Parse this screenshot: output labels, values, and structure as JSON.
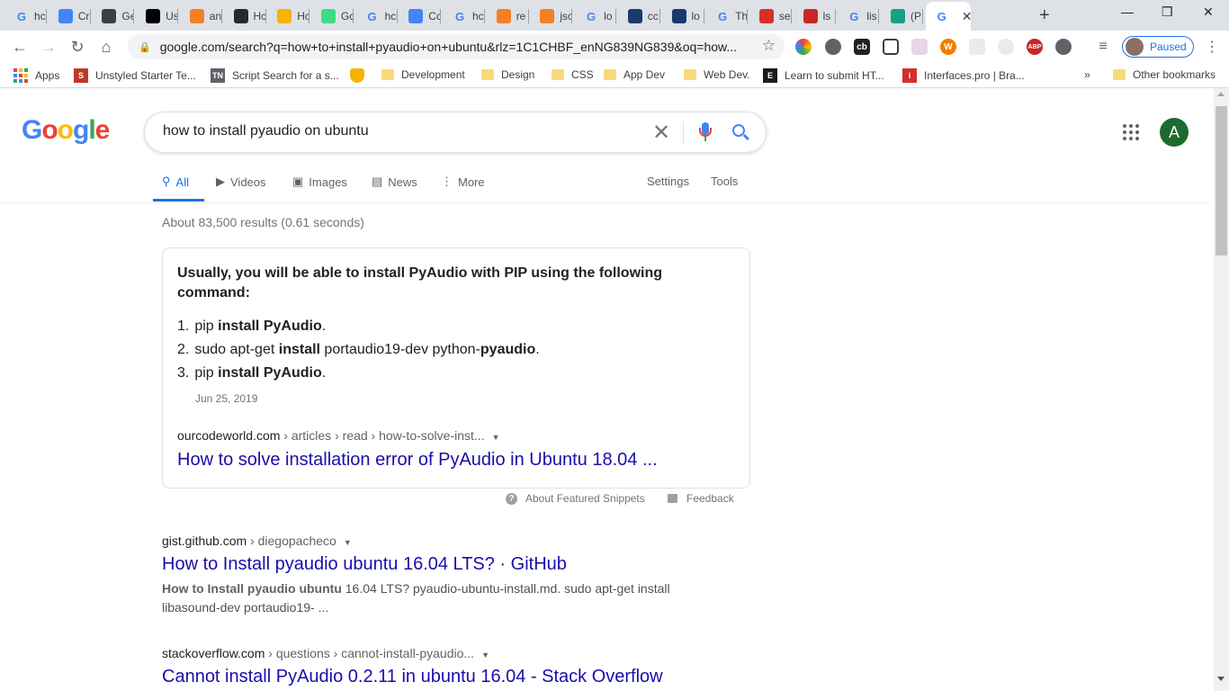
{
  "browser": {
    "tabs": [
      {
        "title": "hc",
        "icon": "google-icon",
        "color": "#4285f4"
      },
      {
        "title": "Cr",
        "icon": "cloud-icon",
        "color": "#4285f4"
      },
      {
        "title": "Ge",
        "icon": "code-icon",
        "color": "#3c4043"
      },
      {
        "title": "Us",
        "icon": "medium-icon",
        "color": "#000000"
      },
      {
        "title": "an",
        "icon": "stackoverflow-icon",
        "color": "#f48024"
      },
      {
        "title": "Hc",
        "icon": "github-icon",
        "color": "#24292e"
      },
      {
        "title": "Hc",
        "icon": "badge-icon",
        "color": "#f4b400"
      },
      {
        "title": "Gc",
        "icon": "android-icon",
        "color": "#3ddc84"
      },
      {
        "title": "hc",
        "icon": "google-icon",
        "color": "#4285f4"
      },
      {
        "title": "Cc",
        "icon": "docs-icon",
        "color": "#4285f4"
      },
      {
        "title": "hc",
        "icon": "google-icon",
        "color": "#4285f4"
      },
      {
        "title": "re",
        "icon": "stackoverflow-icon",
        "color": "#f48024"
      },
      {
        "title": "jsc",
        "icon": "stackoverflow-icon",
        "color": "#f48024"
      },
      {
        "title": "lo",
        "icon": "google-icon",
        "color": "#4285f4"
      },
      {
        "title": "cc",
        "icon": "ul-icon",
        "color": "#1a3a6b"
      },
      {
        "title": "lo",
        "icon": "ul-icon",
        "color": "#1a3a6b"
      },
      {
        "title": "Th",
        "icon": "google-icon",
        "color": "#4285f4"
      },
      {
        "title": "se",
        "icon": "ask-icon",
        "color": "#d93025"
      },
      {
        "title": "ls",
        "icon": "list-icon",
        "color": "#c62828"
      },
      {
        "title": "lis",
        "icon": "google-icon",
        "color": "#4285f4"
      },
      {
        "title": "(P",
        "icon": "r-icon",
        "color": "#16a085"
      },
      {
        "title": "",
        "icon": "google-icon",
        "color": "#4285f4",
        "active": true
      }
    ],
    "url": "google.com/search?q=how+to+install+pyaudio+on+ubuntu&rlz=1C1CHBF_enNG839NG839&oq=how...",
    "profile_status": "Paused",
    "bookmarks": [
      {
        "label": "Apps",
        "type": "apps"
      },
      {
        "label": "Unstyled Starter Te...",
        "type": "site",
        "icon": "S",
        "color": "#c0392b"
      },
      {
        "label": "Script Search for a s...",
        "type": "site",
        "icon": "TN",
        "color": "#5f6368"
      },
      {
        "label": "",
        "type": "site",
        "icon": "shield",
        "color": "#f4b400"
      },
      {
        "label": "Development",
        "type": "folder"
      },
      {
        "label": "Design",
        "type": "folder"
      },
      {
        "label": "CSS",
        "type": "folder"
      },
      {
        "label": "App Dev",
        "type": "folder"
      },
      {
        "label": "Web Dev.",
        "type": "folder"
      },
      {
        "label": "Learn to submit HT...",
        "type": "site",
        "icon": "E",
        "color": "#1b1b1b"
      },
      {
        "label": "Interfaces.pro | Bra...",
        "type": "site",
        "icon": "i",
        "color": "#d32f2f"
      }
    ],
    "more_bookmarks_glyph": "»",
    "other_bookmarks": "Other bookmarks"
  },
  "google": {
    "logo_letters": [
      {
        "ch": "G",
        "color": "#4285f4"
      },
      {
        "ch": "o",
        "color": "#ea4335"
      },
      {
        "ch": "o",
        "color": "#fbbc05"
      },
      {
        "ch": "g",
        "color": "#4285f4"
      },
      {
        "ch": "l",
        "color": "#34a853"
      },
      {
        "ch": "e",
        "color": "#ea4335"
      }
    ],
    "query": "how to install pyaudio on ubuntu",
    "account_initial": "A",
    "tabs": {
      "all": "All",
      "videos": "Videos",
      "images": "Images",
      "news": "News",
      "more": "More",
      "settings": "Settings",
      "tools": "Tools"
    },
    "stats": "About 83,500 results (0.61 seconds)",
    "snippet": {
      "heading": "Usually, you will be able to install PyAudio with PIP using the following command:",
      "steps": [
        {
          "num": "1.",
          "pre": "pip ",
          "b1": "install",
          "mid": " ",
          "b2": "PyAudio",
          "post": "."
        },
        {
          "num": "2.",
          "pre": "sudo apt-get ",
          "b1": "install",
          "mid": " portaudio19-dev python-",
          "b2": "pyaudio",
          "post": "."
        },
        {
          "num": "3.",
          "pre": "pip ",
          "b1": "install",
          "mid": " ",
          "b2": "PyAudio",
          "post": "."
        }
      ],
      "date": "Jun 25, 2019",
      "cite_domain": "ourcodeworld.com",
      "cite_path": " › articles › read › how-to-solve-inst...",
      "title": "How to solve installation error of PyAudio in Ubuntu 18.04 ..."
    },
    "about_snippets": "About Featured Snippets",
    "feedback": "Feedback",
    "results": [
      {
        "cite_domain": "gist.github.com",
        "cite_path": " › diegopacheco",
        "title": "How to Install pyaudio ubuntu 16.04 LTS? · GitHub",
        "desc_bold": "How to Install pyaudio ubuntu",
        "desc_rest": " 16.04 LTS? pyaudio-ubuntu-install.md. sudo apt-get install libasound-dev portaudio19- ..."
      },
      {
        "cite_domain": "stackoverflow.com",
        "cite_path": " › questions › cannot-install-pyaudio...",
        "title": "Cannot install PyAudio 0.2.11 in ubuntu 16.04 - Stack Overflow"
      }
    ]
  }
}
